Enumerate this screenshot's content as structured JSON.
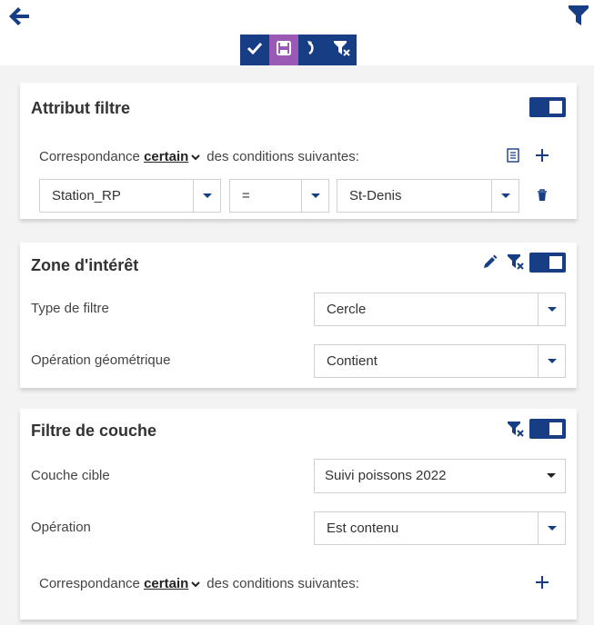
{
  "header": {
    "back_icon": "arrow-left-icon",
    "filter_icon": "funnel-icon",
    "toolbar": [
      "check-icon",
      "save-icon",
      "undo-icon",
      "clear-filter-icon"
    ]
  },
  "attribute_filter": {
    "title": "Attribut filtre",
    "match_prefix": "Correspondance",
    "match_keyword": "certain",
    "match_suffix": "des conditions suivantes:",
    "condition": {
      "field": "Station_RP",
      "operator": "=",
      "value": "St-Denis"
    }
  },
  "zone_of_interest": {
    "title": "Zone d'intérêt",
    "filter_type_label": "Type de filtre",
    "filter_type_value": "Cercle",
    "geometric_op_label": "Opération géométrique",
    "geometric_op_value": "Contient"
  },
  "layer_filter": {
    "title": "Filtre de couche",
    "target_layer_label": "Couche cible",
    "target_layer_value": "Suivi poissons 2022",
    "operation_label": "Opération",
    "operation_value": "Est contenu",
    "match_prefix": "Correspondance",
    "match_keyword": "certain",
    "match_suffix": "des conditions suivantes:"
  },
  "colors": {
    "primary": "#173e84",
    "save_highlight": "#9b59b6"
  }
}
